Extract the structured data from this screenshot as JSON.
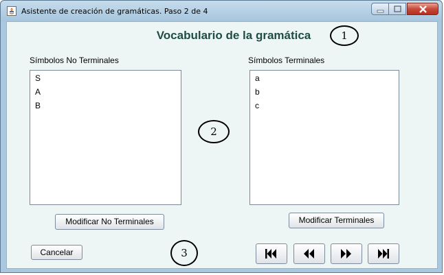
{
  "window": {
    "title": "Asistente de creación de gramáticas. Paso 2 de 4"
  },
  "heading": "Vocabulario de la gramática",
  "non_terminals": {
    "label": "Símbolos No Terminales",
    "items": [
      "S",
      "A",
      "B"
    ],
    "button_label": "Modificar No Terminales"
  },
  "terminals": {
    "label": "Símbolos Terminales",
    "items": [
      "a",
      "b",
      "c"
    ],
    "button_label": "Modificar Terminales"
  },
  "cancel_label": "Cancelar",
  "callouts": [
    "1",
    "2",
    "3"
  ],
  "icons": {
    "nav": [
      "first-page-icon",
      "previous-page-icon",
      "next-page-icon",
      "last-page-icon"
    ],
    "window_controls": [
      "minimize-icon",
      "maximize-icon",
      "close-icon"
    ]
  },
  "colors": {
    "heading": "#1f4d44",
    "panel_background": "#eef5f5",
    "frame": "#a9c8df",
    "close_button": "#c7493a"
  }
}
